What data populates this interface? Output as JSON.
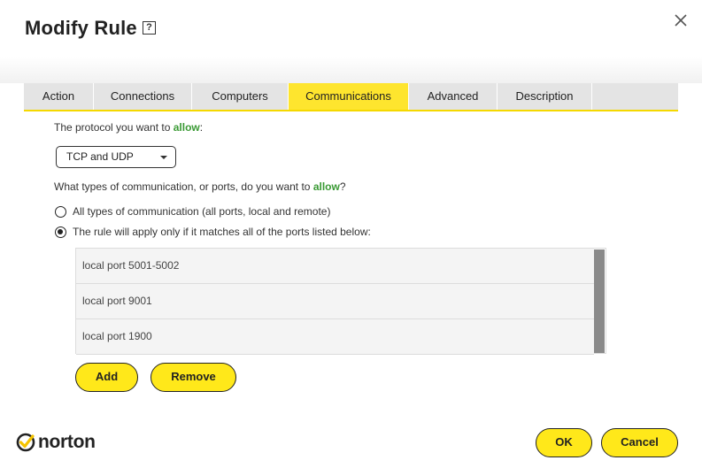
{
  "dialog": {
    "title": "Modify Rule",
    "help_glyph": "?",
    "close_icon": "close-icon"
  },
  "tabs": [
    {
      "label": "Action",
      "active": false
    },
    {
      "label": "Connections",
      "active": false
    },
    {
      "label": "Computers",
      "active": false
    },
    {
      "label": "Communications",
      "active": true
    },
    {
      "label": "Advanced",
      "active": false
    },
    {
      "label": "Description",
      "active": false
    }
  ],
  "protocol": {
    "prompt_prefix": "The protocol you want to ",
    "prompt_emphasis": "allow",
    "prompt_suffix": ":",
    "selected": "TCP and UDP"
  },
  "ports": {
    "prompt_prefix": "What types of communication, or ports, do you want to ",
    "prompt_emphasis": "allow",
    "prompt_suffix": "?",
    "options": [
      {
        "label": "All types of communication (all ports, local and remote)",
        "checked": false
      },
      {
        "label": "The rule will apply only if it matches all of the ports listed below:",
        "checked": true
      }
    ],
    "list": [
      "local port 5001-5002",
      "local port 9001",
      "local port 1900"
    ]
  },
  "buttons": {
    "add": "Add",
    "remove": "Remove",
    "ok": "OK",
    "cancel": "Cancel"
  },
  "brand": {
    "name": "norton",
    "accent": "#ffe81a",
    "tab_active": "#fee52e",
    "allow_color": "#3a9a34"
  }
}
